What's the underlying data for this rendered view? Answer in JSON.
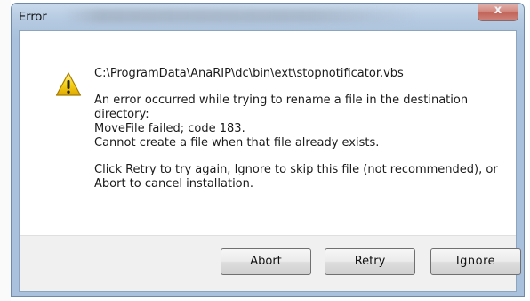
{
  "window": {
    "title": "Error",
    "close_symbol": "x"
  },
  "message": {
    "path": "C:\\ProgramData\\AnaRIP\\dc\\bin\\ext\\stopnotificator.vbs",
    "error_line1": "An error occurred while trying to rename a file in the destination",
    "error_line2": "directory:",
    "error_line3": "MoveFile failed; code 183.",
    "error_line4": "Cannot create a file when that file already exists.",
    "hint_line1": "Click Retry to try again, Ignore to skip this file (not recommended), or",
    "hint_line2": "Abort to cancel installation."
  },
  "buttons": {
    "abort": "Abort",
    "retry": "Retry",
    "ignore": "Ignore"
  },
  "icons": {
    "warning": "warning-icon",
    "close": "close-icon"
  },
  "colors": {
    "title_bar": "#b9cde3",
    "close_button": "#c4412b",
    "footer": "#f0f0f0",
    "warning_yellow": "#f5d21a"
  }
}
